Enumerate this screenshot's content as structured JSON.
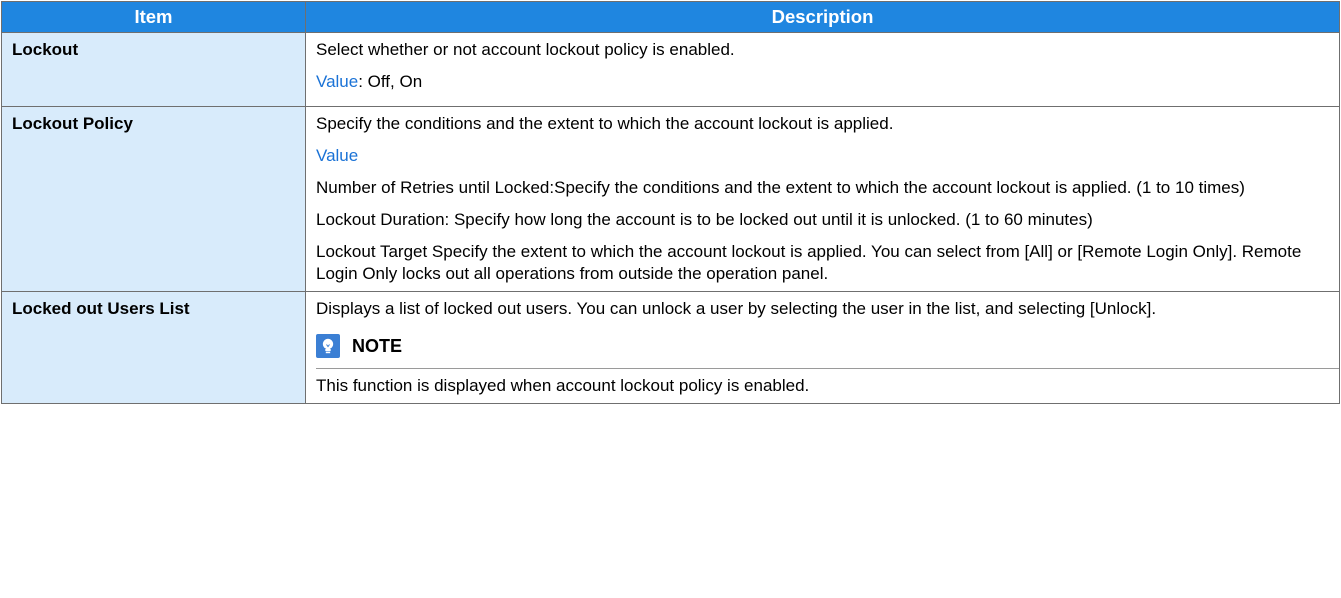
{
  "table": {
    "header": {
      "item": "Item",
      "description": "Description"
    },
    "rows": [
      {
        "item": "Lockout",
        "desc": "Select whether or not account lockout policy is enabled.",
        "value_label": "Value",
        "value_text": ": Off, On"
      },
      {
        "item": "Lockout Policy",
        "desc": "Specify the conditions and the extent to which the account lockout is applied.",
        "value_label": "Value",
        "p1": "Number of Retries until Locked:Specify the conditions and the extent to which the account lockout is applied. (1 to 10 times)",
        "p2": "Lockout Duration: Specify how long the account is to be locked out until it is unlocked. (1 to 60 minutes)",
        "p3": "Lockout Target Specify the extent to which the account lockout is applied. You can select from [All] or [Remote Login Only]. Remote Login Only locks out all operations from outside the operation panel."
      },
      {
        "item": "Locked out Users List",
        "desc": "Displays a list of locked out users. You can unlock a user by selecting the user in the list, and selecting [Unlock].",
        "note_title": "NOTE",
        "note_text": "This function is displayed when account lockout policy is enabled."
      }
    ]
  },
  "colors": {
    "header_bg": "#1f86e0",
    "item_bg": "#d8ebfb",
    "value_blue": "#1a72d6"
  },
  "icons": {
    "note": "lightbulb-note-icon"
  }
}
